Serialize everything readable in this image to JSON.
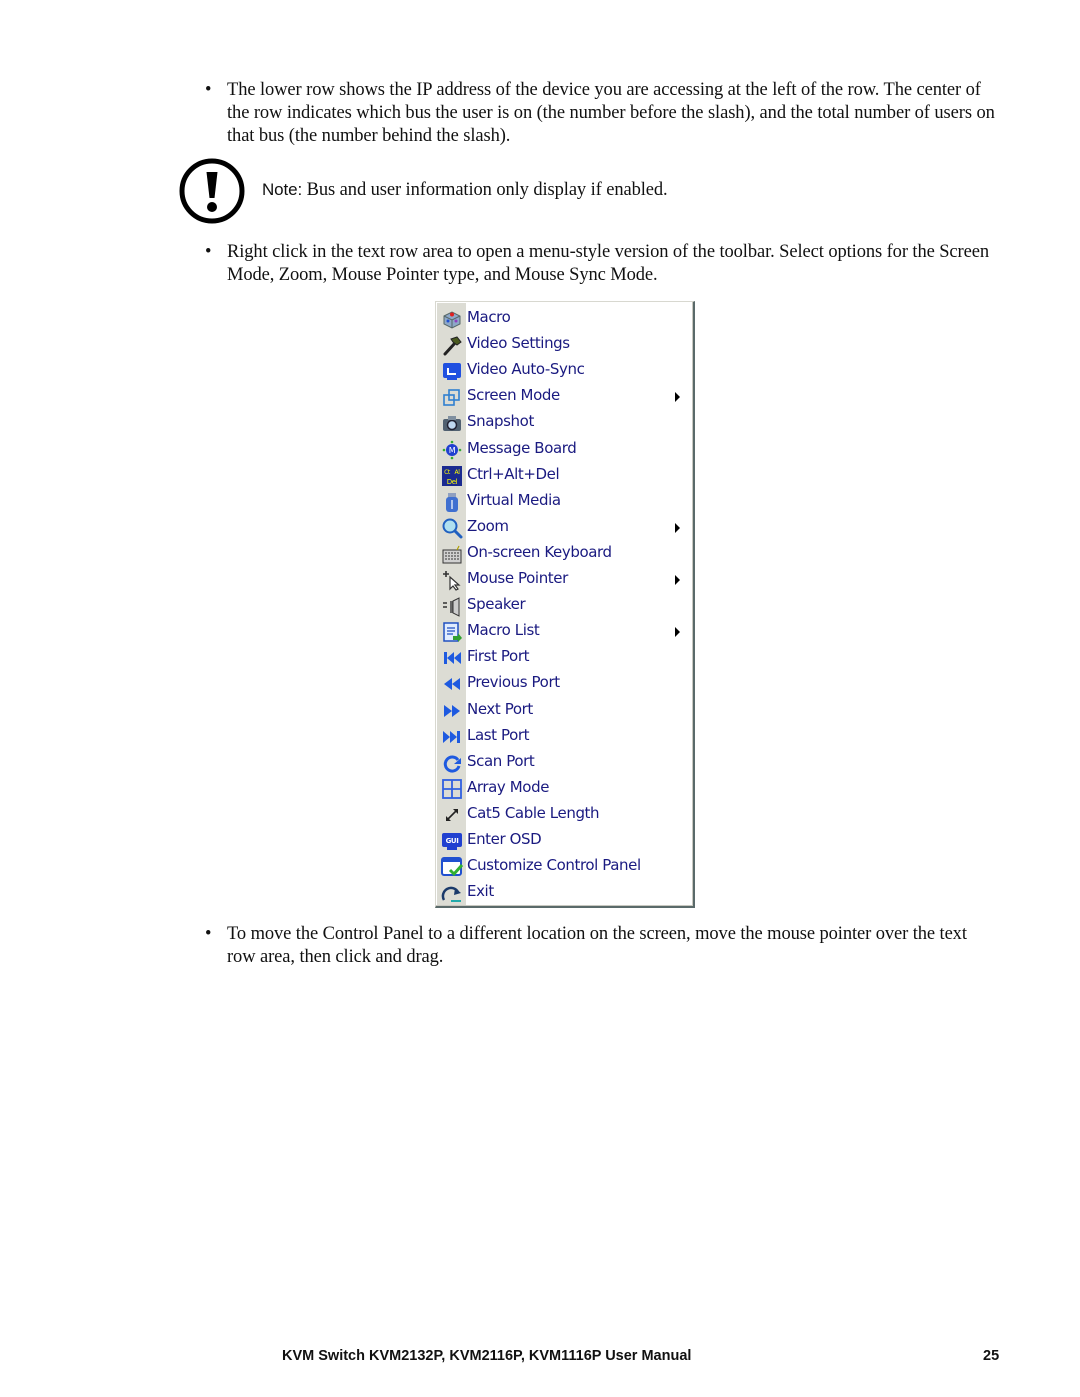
{
  "paragraphs": {
    "bullet_char": "•",
    "lower_row": "The lower row shows the IP address of the device you are accessing at the left of the row. The center of the row indicates which bus the user is on (the number before the slash), and the total number of users on that bus (the number behind the slash).",
    "right_click": "Right click in the text row area to open a menu-style version of the toolbar. Select options for the Screen Mode, Zoom, Mouse Pointer type, and Mouse Sync Mode.",
    "move_panel": "To move the Control Panel to a different location on the screen, move the mouse pointer over the text row area, then click and drag."
  },
  "note": {
    "icon": "exclamation-circle-icon",
    "label": "Note:",
    "text": " Bus and user information only display if enabled."
  },
  "menu": {
    "items": [
      {
        "label": "Macro",
        "icon": "macro-icon",
        "submenu": false
      },
      {
        "label": "Video Settings",
        "icon": "hammer-icon",
        "submenu": false
      },
      {
        "label": "Video Auto-Sync",
        "icon": "video-auto-sync-icon",
        "submenu": false
      },
      {
        "label": "Screen Mode",
        "icon": "screen-mode-icon",
        "submenu": true
      },
      {
        "label": "Snapshot",
        "icon": "camera-icon",
        "submenu": false
      },
      {
        "label": "Message Board",
        "icon": "message-board-icon",
        "submenu": false
      },
      {
        "label": "Ctrl+Alt+Del",
        "icon": "ctrl-alt-del-icon",
        "submenu": false
      },
      {
        "label": "Virtual Media",
        "icon": "usb-drive-icon",
        "submenu": false
      },
      {
        "label": "Zoom",
        "icon": "magnifier-icon",
        "submenu": true
      },
      {
        "label": "On-screen Keyboard",
        "icon": "keyboard-icon",
        "submenu": false
      },
      {
        "label": "Mouse Pointer",
        "icon": "mouse-pointer-icon",
        "submenu": true
      },
      {
        "label": "Speaker",
        "icon": "speaker-icon",
        "submenu": false
      },
      {
        "label": "Macro List",
        "icon": "macro-list-icon",
        "submenu": true
      },
      {
        "label": "First Port",
        "icon": "first-port-icon",
        "submenu": false
      },
      {
        "label": "Previous Port",
        "icon": "previous-port-icon",
        "submenu": false
      },
      {
        "label": "Next Port",
        "icon": "next-port-icon",
        "submenu": false
      },
      {
        "label": "Last Port",
        "icon": "last-port-icon",
        "submenu": false
      },
      {
        "label": "Scan Port",
        "icon": "scan-port-icon",
        "submenu": false
      },
      {
        "label": "Array Mode",
        "icon": "array-mode-icon",
        "submenu": false
      },
      {
        "label": "Cat5 Cable Length",
        "icon": "cable-length-icon",
        "submenu": false
      },
      {
        "label": "Enter OSD",
        "icon": "gui-osd-icon",
        "submenu": false
      },
      {
        "label": "Customize Control Panel",
        "icon": "customize-panel-icon",
        "submenu": false
      },
      {
        "label": "Exit",
        "icon": "exit-icon",
        "submenu": false
      }
    ]
  },
  "footer": {
    "title": "KVM Switch KVM2132P, KVM2116P, KVM1116P User Manual",
    "page_number": "25"
  }
}
